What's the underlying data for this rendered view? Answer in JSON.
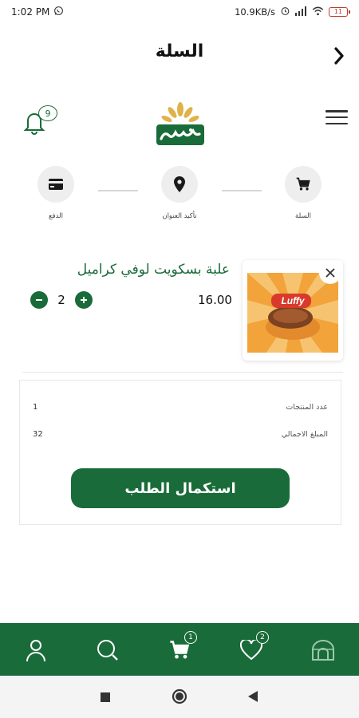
{
  "status_bar": {
    "time": "1:02 PM",
    "speed": "10.9KB/s",
    "battery": "11"
  },
  "header": {
    "title": "السلة"
  },
  "notifications": {
    "count": "9"
  },
  "steps": [
    {
      "label": "السلة",
      "icon": "cart-icon"
    },
    {
      "label": "تأكيد العنوان",
      "icon": "location-pin-icon"
    },
    {
      "label": "الدفع",
      "icon": "credit-card-icon"
    }
  ],
  "cart_item": {
    "name": "علبة بسكويت لوفي كراميل",
    "price": "16.00",
    "quantity": "2",
    "image_brand_text": "Luffy"
  },
  "summary": {
    "items_count_label": "عدد المنتجات",
    "items_count": "1",
    "total_label": "المبلغ الاجمالي",
    "total": "32",
    "checkout_label": "استكمال الطلب"
  },
  "bottom_nav": {
    "cart_badge": "1",
    "favorites_badge": "2"
  },
  "colors": {
    "primary_green": "#1a6b3a",
    "logo_gold": "#e0b24a"
  }
}
